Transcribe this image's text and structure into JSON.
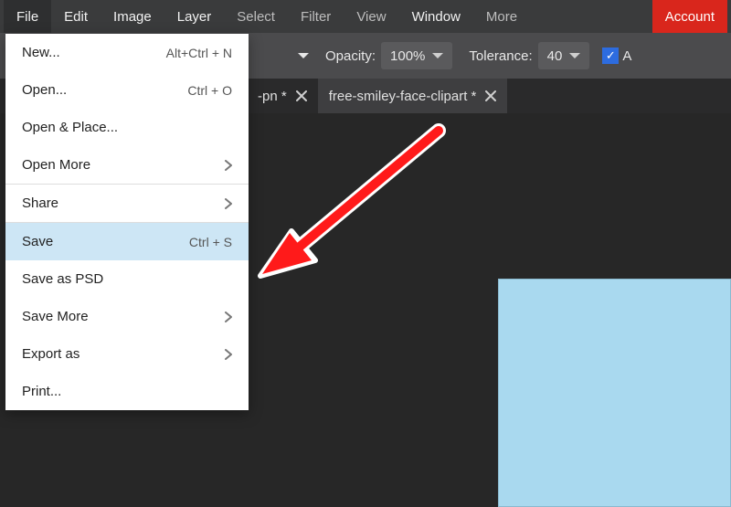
{
  "menubar": {
    "items": [
      "File",
      "Edit",
      "Image",
      "Layer",
      "Select",
      "Filter",
      "View",
      "Window",
      "More",
      "Account"
    ]
  },
  "optionsbar": {
    "opacity_label": "Opacity:",
    "opacity_value": "100%",
    "tolerance_label": "Tolerance:",
    "tolerance_value": "40",
    "checkbox_checked": true,
    "trail": "A"
  },
  "tabs": [
    {
      "label": "-pn *"
    },
    {
      "label": "free-smiley-face-clipart *"
    }
  ],
  "file_menu": {
    "items": [
      {
        "label": "New...",
        "shortcut": "Alt+Ctrl + N",
        "type": "item"
      },
      {
        "label": "Open...",
        "shortcut": "Ctrl + O",
        "type": "item"
      },
      {
        "label": "Open & Place...",
        "type": "item"
      },
      {
        "label": "Open More",
        "type": "submenu"
      },
      {
        "type": "separator"
      },
      {
        "label": "Share",
        "type": "submenu"
      },
      {
        "type": "separator"
      },
      {
        "label": "Save",
        "shortcut": "Ctrl + S",
        "type": "item",
        "selected": true
      },
      {
        "label": "Save as PSD",
        "type": "item"
      },
      {
        "label": "Save More",
        "type": "submenu"
      },
      {
        "label": "Export as",
        "type": "submenu"
      },
      {
        "label": "Print...",
        "type": "item"
      }
    ]
  },
  "colors": {
    "canvas_swatch": "#a9d9ef",
    "arrow": "#ff1a1a"
  }
}
